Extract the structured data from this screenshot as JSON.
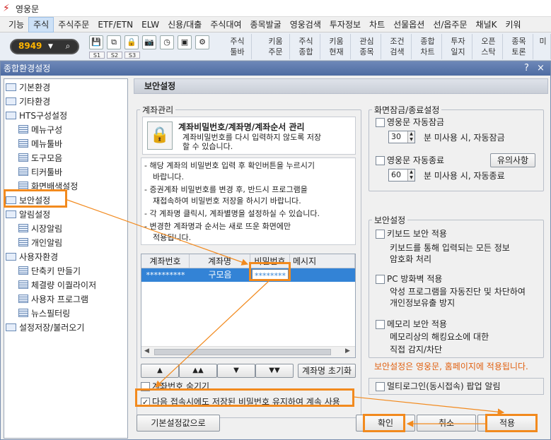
{
  "app": {
    "title": "영웅문"
  },
  "menu": [
    "기능",
    "주식",
    "주식주문",
    "ETF/ETN",
    "ELW",
    "신용/대출",
    "주식대여",
    "종목발굴",
    "영웅검색",
    "투자정보",
    "차트",
    "선물옵션",
    "선/옵주문",
    "채널K",
    "키워"
  ],
  "toolbar": {
    "account": "8949",
    "small_labels": [
      "S1",
      "S2",
      "S3"
    ],
    "buttons": [
      [
        "주식",
        "툴바"
      ],
      [
        "키움",
        "주문"
      ],
      [
        "주식",
        "종합"
      ],
      [
        "키움",
        "현재"
      ],
      [
        "관심",
        "종목"
      ],
      [
        "조건",
        "검색"
      ],
      [
        "종합",
        "차트"
      ],
      [
        "투자",
        "일지"
      ],
      [
        "오픈",
        "스탁"
      ],
      [
        "종목",
        "토론"
      ],
      [
        "미",
        ""
      ]
    ]
  },
  "dialog": {
    "title": "종합환경설정",
    "help": "?",
    "close": "×"
  },
  "tree": {
    "items": [
      "기본환경",
      "기타환경",
      "HTS구성설정",
      "메뉴구성",
      "메뉴툴바",
      "도구모음",
      "티커툴바",
      "화면배색설정",
      "보안설정",
      "알림설정",
      "시장알림",
      "개인알림",
      "사용자환경",
      "단축키 만들기",
      "체결량 이퀄라이저",
      "사용자 프로그램",
      "뉴스필터링",
      "설정저장/불러오기"
    ]
  },
  "panel": {
    "title": "보안설정",
    "account_group": {
      "legend": "계좌관리",
      "header_title": "계좌비밀번호/계좌명/계좌순서 관리",
      "header_desc": [
        "계좌비밀번호를 다시 입력하지 않도록 저장",
        "할 수 있습니다."
      ],
      "notes": [
        "- 해당 계좌의 비밀번호 입력 후 확인버튼을 누르시기",
        "바랍니다.",
        "- 증권계좌 비밀번호를 변경 후, 반드시 프로그램을",
        "재접속하여 비밀번호 저장을 하시기 바랍니다.",
        "- 각 계좌명 클릭시, 계좌별명을 설정하실 수 있습니다.",
        "- 변경한 계좌명과 순서는 새로 뜨운 화면에만",
        "적용됩니다."
      ],
      "table": {
        "headers": [
          "계좌번호",
          "계좌명",
          "비밀번호",
          "메시지"
        ],
        "row": [
          "**********",
          "구모음",
          "********",
          ""
        ]
      },
      "order_buttons": [
        "▲",
        "▲▲",
        "▼",
        "▼▼"
      ],
      "reset_names": "계좌명 초기화",
      "hide_account": "계좌번호 숨기기",
      "keep_password": "다음 접속시에도 저장된 비밀번호 유지하여 계속 사용"
    },
    "lock_group": {
      "legend": "화면잠금/종료설정",
      "auto_lock": "영웅문 자동잠금",
      "lock_minutes": "30",
      "lock_suffix": "분 미사용 시, 자동잠금",
      "auto_exit": "영웅문 자동종료",
      "notice_button": "유의사항",
      "exit_minutes": "60",
      "exit_suffix": "분 미사용 시, 자동종료"
    },
    "security_group": {
      "legend": "보안설정",
      "keyboard": "키보드 보안 적용",
      "keyboard_desc": [
        "키보드를 통해 입력되는 모든 정보",
        "암호화 처리"
      ],
      "firewall": "PC 방화벽 적용",
      "firewall_desc": [
        "악성 프로그램을 자동진단 및 차단하여",
        "개인정보유출 방지"
      ],
      "memory": "메모리 보안 적용",
      "memory_desc": [
        "메모리상의 해킹요소에 대한",
        "직접 감지/차단"
      ],
      "notice": "보안설정은 영웅문, 홈페이지에 적용됩니다."
    },
    "multi_login": "멀티로그인(동시접속) 팝업 알림"
  },
  "footer": {
    "defaults": "기본설정값으로",
    "ok": "확인",
    "cancel": "취소",
    "apply": "적용"
  },
  "colors": {
    "highlight": "#f28a1e",
    "notice": "#e06010",
    "selection": "#3383d6"
  }
}
